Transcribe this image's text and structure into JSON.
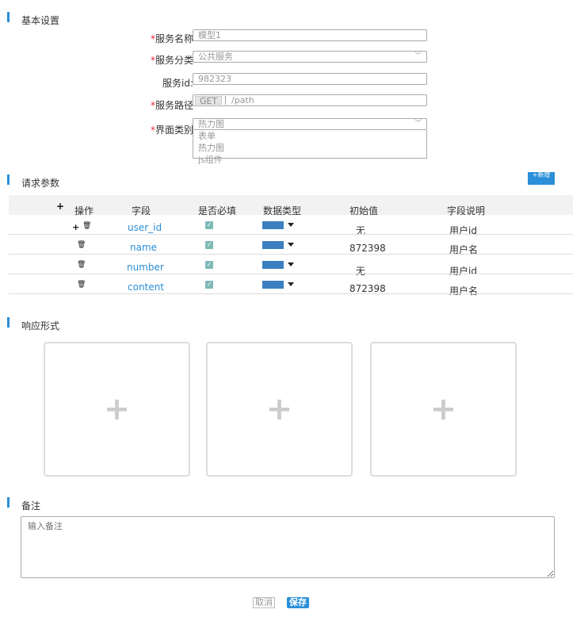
{
  "sections": {
    "basic": "基本设置",
    "request": "请求参数",
    "response": "响应形式",
    "remark": "备注"
  },
  "form": {
    "service_name": {
      "label": "服务名称",
      "value": "模型1"
    },
    "service_category": {
      "label": "服务分类",
      "value": "公共服务"
    },
    "service_id": {
      "label": "服务id:",
      "value": "982323"
    },
    "service_path": {
      "label": "服务路径",
      "method": "GET",
      "value": "/path"
    },
    "ui_type": {
      "label": "界面类别",
      "value": "热力图",
      "options": [
        "表单",
        "热力图",
        "js组件"
      ]
    }
  },
  "request_params": {
    "new_button": "新增",
    "columns": [
      "操作",
      "字段",
      "是否必填",
      "数据类型",
      "初始值",
      "字段说明"
    ],
    "rows": [
      {
        "field": "user_id",
        "initial": "无",
        "desc": "用户id"
      },
      {
        "field": "name",
        "initial": "872398",
        "desc": "用户名"
      },
      {
        "field": "number",
        "initial": "无",
        "desc": "用户id"
      },
      {
        "field": "content",
        "initial": "872398",
        "desc": "用户名"
      }
    ]
  },
  "remark": {
    "placeholder": "输入备注"
  },
  "buttons": {
    "cancel": "取消",
    "save": "保存"
  },
  "colors": {
    "accent": "#2a8ed8",
    "required": "#e23"
  }
}
